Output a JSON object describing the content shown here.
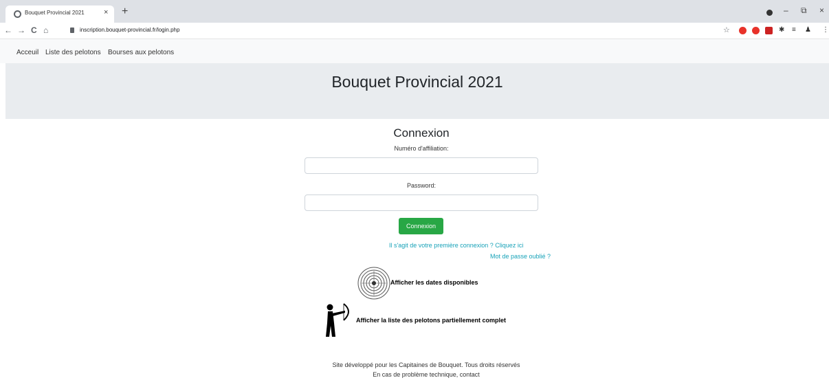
{
  "browser": {
    "tab_title": "Bouquet Provincial 2021",
    "tab_close": "×",
    "new_tab": "+",
    "url": "inscription.bouquet-provincial.fr/login.php",
    "nav": {
      "back": "←",
      "forward": "→",
      "reload": "C",
      "home": "⌂",
      "star": "☆"
    },
    "window": {
      "minimize": "–",
      "restore": "⧉",
      "close": "×"
    },
    "extension_colors": [
      "#e8322a",
      "#e8322a",
      "#cc2222",
      "#333333"
    ]
  },
  "site_nav": {
    "items": [
      {
        "label": "Acceuil"
      },
      {
        "label": "Liste des pelotons"
      },
      {
        "label": "Bourses aux pelotons"
      }
    ]
  },
  "header": {
    "title": "Bouquet Provincial 2021"
  },
  "login": {
    "title": "Connexion",
    "affiliation_label": "Numéro d'affiliation:",
    "affiliation_value": "",
    "password_label": "Password:",
    "password_value": "",
    "submit_label": "Connexion",
    "first_login_link": "Il s'agit de votre première connexion ? Cliquez ici",
    "forgot_link": "Mot de passe oublié ?"
  },
  "features": {
    "dates_label": "Afficher les dates disponibles",
    "pelotons_label": "Afficher la liste des pelotons partiellement complet"
  },
  "footer": {
    "line1": "Site développé pour les Capitaines de Bouquet. Tous droits réservés",
    "line2": "En cas de problème technique, contact"
  },
  "colors": {
    "primary_button": "#28a745",
    "link": "#17a2b8",
    "jumbotron": "#e9ecef"
  }
}
